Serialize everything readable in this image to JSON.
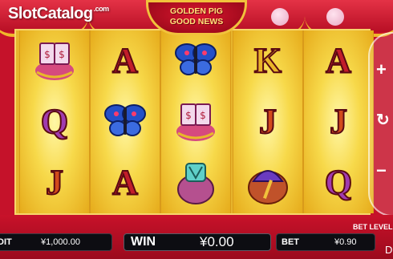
{
  "watermark": {
    "brand": "SlotCatalog",
    "suffix": ".com"
  },
  "game": {
    "title_line1": "GOLDEN PIG",
    "title_line2": "GOOD NEWS"
  },
  "reels": [
    [
      "pig-lantern",
      "Q",
      "J"
    ],
    [
      "A",
      "butterfly",
      "A"
    ],
    [
      "butterfly",
      "pig-lantern",
      "money-bag"
    ],
    [
      "K",
      "J",
      "fan"
    ],
    [
      "A",
      "J",
      "Q"
    ]
  ],
  "controls": {
    "plus": "+",
    "spin": "↻",
    "minus": "−"
  },
  "status": {
    "credit_label": "DIT",
    "credit_value": "¥1,000.00",
    "win_label": "WIN",
    "win_value": "¥0.00",
    "bet_label": "BET",
    "bet_value": "¥0.90",
    "bet_level_label": "BET LEVEL",
    "corner_text": "D"
  },
  "colors": {
    "frame_red": "#c5122a",
    "reel_gold": "#f7d94a",
    "accent_gold": "#f1c23c"
  }
}
